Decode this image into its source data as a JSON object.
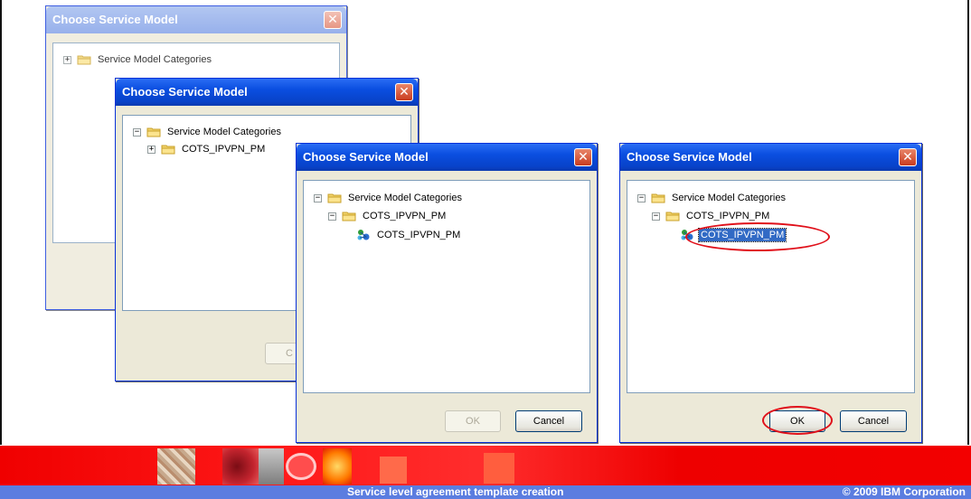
{
  "dialogs": [
    {
      "title": "Choose Service Model",
      "close": "✕",
      "tree": [
        {
          "toggle": "+",
          "label": "Service Model Categories"
        }
      ]
    },
    {
      "title": "Choose Service Model",
      "close": "✕",
      "button_partial": "C",
      "tree": [
        {
          "toggle": "−",
          "label": "Service Model Categories"
        },
        {
          "toggle": "+",
          "label": "COTS_IPVPN_PM"
        }
      ]
    },
    {
      "title": "Choose Service Model",
      "close": "✕",
      "ok_label": "OK",
      "cancel_label": "Cancel",
      "tree": [
        {
          "toggle": "−",
          "label": "Service Model Categories"
        },
        {
          "toggle": "−",
          "label": "COTS_IPVPN_PM"
        },
        {
          "label": "COTS_IPVPN_PM"
        }
      ]
    },
    {
      "title": "Choose Service Model",
      "close": "✕",
      "ok_label": "OK",
      "cancel_label": "Cancel",
      "tree": [
        {
          "toggle": "−",
          "label": "Service Model Categories"
        },
        {
          "toggle": "−",
          "label": "COTS_IPVPN_PM"
        },
        {
          "label": "COTS_IPVPN_PM",
          "selected": true
        }
      ]
    }
  ],
  "footer": {
    "title": "Service level agreement template creation",
    "copyright": "© 2009 IBM Corporation"
  },
  "colors": {
    "titlebar": "#0a4ee0",
    "highlight_ring": "#e0101a",
    "footer_red": "#f00000",
    "footer_blue": "#5b7de0"
  }
}
